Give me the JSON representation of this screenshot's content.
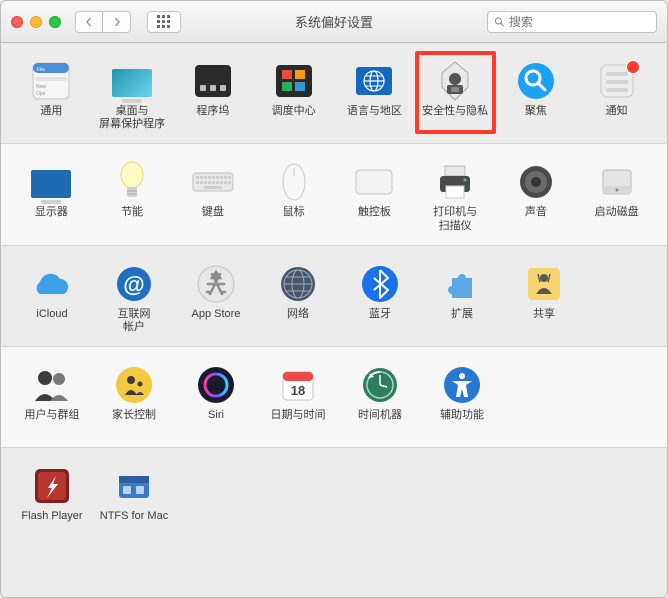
{
  "titlebar": {
    "title": "系统偏好设置",
    "search_placeholder": "搜索"
  },
  "rows": [
    {
      "items": [
        {
          "id": "general",
          "label": "通用"
        },
        {
          "id": "desktop",
          "label": "桌面与\n屏幕保护程序"
        },
        {
          "id": "dock",
          "label": "程序坞"
        },
        {
          "id": "mission",
          "label": "调度中心"
        },
        {
          "id": "lang",
          "label": "语言与地区"
        },
        {
          "id": "security",
          "label": "安全性与隐私",
          "highlight": true
        },
        {
          "id": "spotlight",
          "label": "聚焦"
        },
        {
          "id": "notifications",
          "label": "通知",
          "badge": true
        }
      ]
    },
    {
      "items": [
        {
          "id": "displays",
          "label": "显示器"
        },
        {
          "id": "energy",
          "label": "节能"
        },
        {
          "id": "keyboard",
          "label": "键盘"
        },
        {
          "id": "mouse",
          "label": "鼠标"
        },
        {
          "id": "trackpad",
          "label": "触控板"
        },
        {
          "id": "printers",
          "label": "打印机与\n扫描仪"
        },
        {
          "id": "sound",
          "label": "声音"
        },
        {
          "id": "startup",
          "label": "启动磁盘"
        }
      ]
    },
    {
      "items": [
        {
          "id": "icloud",
          "label": "iCloud"
        },
        {
          "id": "internet",
          "label": "互联网\n帐户"
        },
        {
          "id": "appstore",
          "label": "App Store"
        },
        {
          "id": "network",
          "label": "网络"
        },
        {
          "id": "bluetooth",
          "label": "蓝牙"
        },
        {
          "id": "extensions",
          "label": "扩展"
        },
        {
          "id": "sharing",
          "label": "共享"
        }
      ]
    },
    {
      "items": [
        {
          "id": "users",
          "label": "用户与群组"
        },
        {
          "id": "parental",
          "label": "家长控制"
        },
        {
          "id": "siri",
          "label": "Siri"
        },
        {
          "id": "datetime",
          "label": "日期与时间"
        },
        {
          "id": "timemachine",
          "label": "时间机器"
        },
        {
          "id": "accessibility",
          "label": "辅助功能"
        }
      ]
    },
    {
      "items": [
        {
          "id": "flash",
          "label": "Flash Player"
        },
        {
          "id": "ntfs",
          "label": "NTFS for Mac"
        }
      ]
    }
  ]
}
